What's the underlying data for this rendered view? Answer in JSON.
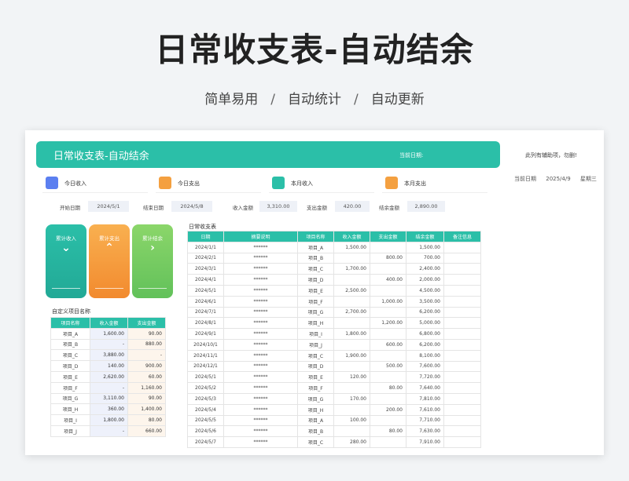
{
  "hero": {
    "title": "日常收支表-自动结余",
    "subtitles": [
      "简单易用",
      "自动统计",
      "自动更新"
    ],
    "separator": "/"
  },
  "header": {
    "title": "日常收支表-自动结余",
    "date_label": "当前日期:"
  },
  "right": {
    "note": "此列有辅助项，勿删!",
    "date_label": "当前日期",
    "date_value": "2025/4/9",
    "weekday": "星期三"
  },
  "cards": [
    {
      "label": "今日收入",
      "color": "#5b7ff0"
    },
    {
      "label": "今日支出",
      "color": "#f4a040"
    },
    {
      "label": "本月收入",
      "color": "#2bbfa8"
    },
    {
      "label": "本月支出",
      "color": "#f4a040"
    }
  ],
  "filter": {
    "start_label": "开始日期",
    "start_value": "2024/5/1",
    "end_label": "结束日期",
    "end_value": "2024/5/8",
    "income_label": "收入金额",
    "income_value": "3,310.00",
    "expense_label": "支出金额",
    "expense_value": "420.00",
    "balance_label": "结余金额",
    "balance_value": "2,890.00"
  },
  "big_cards": [
    {
      "label": "累计收入",
      "icon": "chevron-down-icon",
      "glyph": "⌄"
    },
    {
      "label": "累计支出",
      "icon": "chevron-up-icon",
      "glyph": "⌃"
    },
    {
      "label": "累计结余",
      "icon": "chevron-right-icon",
      "glyph": "›"
    }
  ],
  "custom": {
    "title": "自定义项目名称",
    "headers": [
      "项目名称",
      "收入金额",
      "支出金额"
    ],
    "rows": [
      [
        "项目_A",
        "1,600.00",
        "90.00"
      ],
      [
        "项目_B",
        "-",
        "880.00"
      ],
      [
        "项目_C",
        "3,880.00",
        "-"
      ],
      [
        "项目_D",
        "140.00",
        "900.00"
      ],
      [
        "项目_E",
        "2,620.00",
        "60.00"
      ],
      [
        "项目_F",
        "-",
        "1,160.00"
      ],
      [
        "项目_G",
        "3,110.00",
        "90.00"
      ],
      [
        "项目_H",
        "360.00",
        "1,400.00"
      ],
      [
        "项目_I",
        "1,800.00",
        "80.00"
      ],
      [
        "项目_J",
        "-",
        "660.00"
      ]
    ]
  },
  "main": {
    "title": "日常收支表",
    "headers": [
      "日期",
      "摘要说明",
      "项目名称",
      "收入金额",
      "支出金额",
      "结余金额",
      "备注信息"
    ],
    "rows": [
      [
        "2024/1/1",
        "******",
        "项目_A",
        "1,500.00",
        "",
        "1,500.00",
        ""
      ],
      [
        "2024/2/1",
        "******",
        "项目_B",
        "",
        "800.00",
        "700.00",
        ""
      ],
      [
        "2024/3/1",
        "******",
        "项目_C",
        "1,700.00",
        "",
        "2,400.00",
        ""
      ],
      [
        "2024/4/1",
        "******",
        "项目_D",
        "",
        "400.00",
        "2,000.00",
        ""
      ],
      [
        "2024/5/1",
        "******",
        "项目_E",
        "2,500.00",
        "",
        "4,500.00",
        ""
      ],
      [
        "2024/6/1",
        "******",
        "项目_F",
        "",
        "1,000.00",
        "3,500.00",
        ""
      ],
      [
        "2024/7/1",
        "******",
        "项目_G",
        "2,700.00",
        "",
        "6,200.00",
        ""
      ],
      [
        "2024/8/1",
        "******",
        "项目_H",
        "",
        "1,200.00",
        "5,000.00",
        ""
      ],
      [
        "2024/9/1",
        "******",
        "项目_I",
        "1,800.00",
        "",
        "6,800.00",
        ""
      ],
      [
        "2024/10/1",
        "******",
        "项目_J",
        "",
        "600.00",
        "6,200.00",
        ""
      ],
      [
        "2024/11/1",
        "******",
        "项目_C",
        "1,900.00",
        "",
        "8,100.00",
        ""
      ],
      [
        "2024/12/1",
        "******",
        "项目_D",
        "",
        "500.00",
        "7,600.00",
        ""
      ],
      [
        "2024/5/1",
        "******",
        "项目_E",
        "120.00",
        "",
        "7,720.00",
        ""
      ],
      [
        "2024/5/2",
        "******",
        "项目_F",
        "",
        "80.00",
        "7,640.00",
        ""
      ],
      [
        "2024/5/3",
        "******",
        "项目_G",
        "170.00",
        "",
        "7,810.00",
        ""
      ],
      [
        "2024/5/4",
        "******",
        "项目_H",
        "",
        "200.00",
        "7,610.00",
        ""
      ],
      [
        "2024/5/5",
        "******",
        "项目_A",
        "100.00",
        "",
        "7,710.00",
        ""
      ],
      [
        "2024/5/6",
        "******",
        "项目_B",
        "",
        "80.00",
        "7,630.00",
        ""
      ],
      [
        "2024/5/7",
        "******",
        "项目_C",
        "280.00",
        "",
        "7,910.00",
        ""
      ]
    ]
  }
}
